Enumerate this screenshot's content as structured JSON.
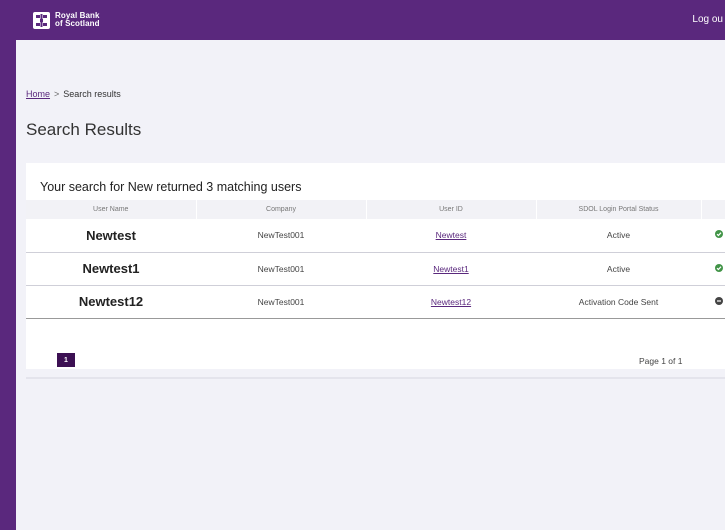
{
  "header": {
    "logo_line1": "Royal Bank",
    "logo_line2": "of Scotland",
    "logout_label": "Log ou"
  },
  "breadcrumb": {
    "home_label": "Home",
    "separator": ">",
    "current": "Search results"
  },
  "page_title": "Search Results",
  "results": {
    "summary": "Your search for New returned 3 matching users",
    "columns": [
      "User Name",
      "Company",
      "User ID",
      "SDOL Login Portal Status",
      ""
    ],
    "rows": [
      {
        "user_name": "Newtest",
        "company": "NewTest001",
        "user_id": "Newtest",
        "status": "Active",
        "status_icon": "check-circle-icon"
      },
      {
        "user_name": "Newtest1",
        "company": "NewTest001",
        "user_id": "Newtest1",
        "status": "Active",
        "status_icon": "check-circle-icon"
      },
      {
        "user_name": "Newtest12",
        "company": "NewTest001",
        "user_id": "Newtest12",
        "status": "Activation Code Sent",
        "status_icon": "minus-circle-icon"
      }
    ]
  },
  "pagination": {
    "current_page_label": "1",
    "page_count_text": "Page 1 of 1"
  },
  "colors": {
    "brand_purple": "#5a287d",
    "background": "#f2f2f8",
    "status_ok": "#429448",
    "status_pending": "#444444"
  }
}
